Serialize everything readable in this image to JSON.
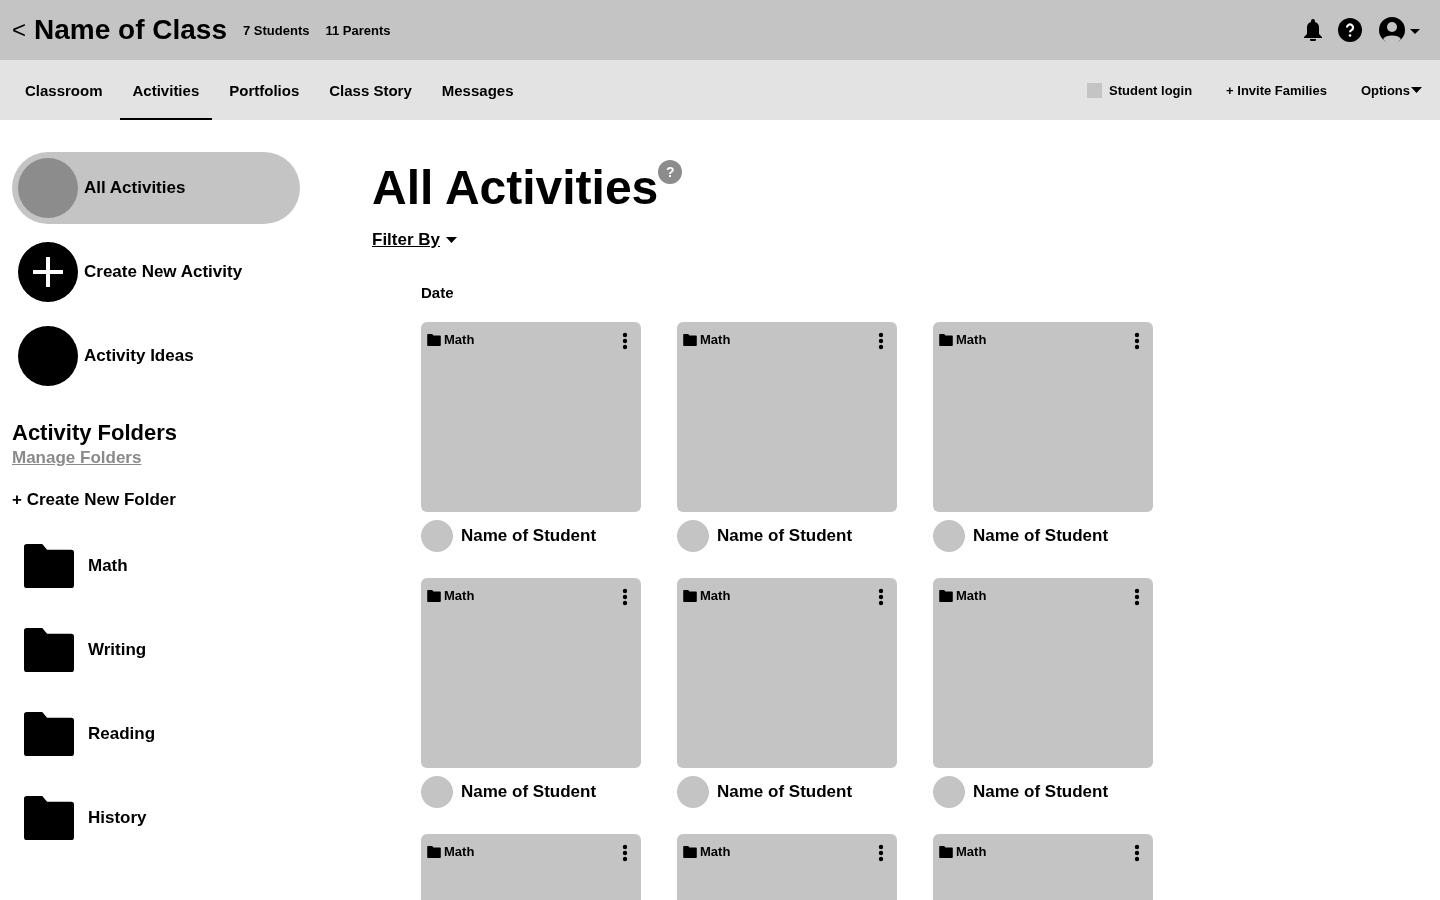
{
  "header": {
    "back": "<",
    "title": "Name of Class",
    "students": "7 Students",
    "parents": "11 Parents"
  },
  "tabs": [
    {
      "label": "Classroom",
      "selected": false
    },
    {
      "label": "Activities",
      "selected": true
    },
    {
      "label": "Portfolios",
      "selected": false
    },
    {
      "label": "Class Story",
      "selected": false
    },
    {
      "label": "Messages",
      "selected": false
    }
  ],
  "nav_actions": {
    "student_login": {
      "label": "Student login",
      "checked": false
    },
    "invite": "+ Invite Families",
    "options": "Options"
  },
  "sidebar": {
    "items": [
      {
        "label": "All Activities",
        "kind": "avatar",
        "selected": true
      },
      {
        "label": "Create New Activity",
        "kind": "plus",
        "selected": false
      },
      {
        "label": "Activity Ideas",
        "kind": "dot",
        "selected": false
      }
    ],
    "folders_heading": "Activity Folders",
    "manage": "Manage Folders",
    "create_folder": "+ Create New Folder",
    "folders": [
      "Math",
      "Writing",
      "Reading",
      "History"
    ]
  },
  "main": {
    "title": "All Activities",
    "help": "?",
    "filter": "Filter By",
    "group": "Date",
    "cards": [
      {
        "folder": "Math",
        "student": "Name of Student"
      },
      {
        "folder": "Math",
        "student": "Name of Student"
      },
      {
        "folder": "Math",
        "student": "Name of Student"
      },
      {
        "folder": "Math",
        "student": "Name of Student"
      },
      {
        "folder": "Math",
        "student": "Name of Student"
      },
      {
        "folder": "Math",
        "student": "Name of Student"
      },
      {
        "folder": "Math"
      },
      {
        "folder": "Math"
      },
      {
        "folder": "Math"
      }
    ]
  }
}
